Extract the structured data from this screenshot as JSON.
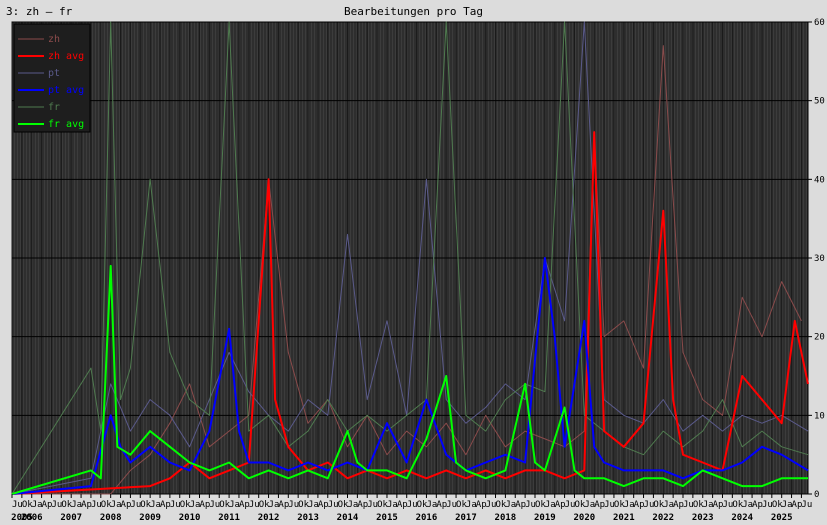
{
  "header": {
    "panel_title": "3: zh – fr",
    "chart_title": "Bearbeitungen pro Tag"
  },
  "colors": {
    "page_background": "#dcdcdc",
    "plot_background": "#2e2e2e",
    "grid": "#000000",
    "zh": "#8a4b4b",
    "zh_avg": "#ff0000",
    "pt": "#5a5a8a",
    "pt_avg": "#0000ff",
    "fr": "#4f7a4f",
    "fr_avg": "#00ff00"
  },
  "chart_data": {
    "type": "line",
    "title": "Bearbeitungen pro Tag",
    "y_axis_position": "right",
    "ylim": [
      0,
      60
    ],
    "yticks": [
      "0",
      "10",
      "20",
      "30",
      "40",
      "50",
      "60"
    ],
    "grid": true,
    "legend_position": "top-left",
    "x_start": "2005-07",
    "x_end": "2025-09",
    "year_labels": [
      "2005",
      "2006",
      "2007",
      "2008",
      "2009",
      "2010",
      "2011",
      "2012",
      "2013",
      "2014",
      "2015",
      "2016",
      "2017",
      "2018",
      "2019",
      "2020",
      "2021",
      "2022",
      "2023",
      "2024",
      "2025"
    ],
    "month_tick_labels": [
      "Ju",
      "Ok",
      "Ja",
      "Ap"
    ],
    "series": [
      {
        "name": "zh",
        "key": "zh",
        "kind": "raw",
        "points": [
          [
            "2005-07",
            0
          ],
          [
            "2008-01",
            0
          ],
          [
            "2008-07",
            3
          ],
          [
            "2009-01",
            5
          ],
          [
            "2009-07",
            9
          ],
          [
            "2010-01",
            14
          ],
          [
            "2010-07",
            6
          ],
          [
            "2011-01",
            8
          ],
          [
            "2011-07",
            10
          ],
          [
            "2012-01",
            40
          ],
          [
            "2012-07",
            18
          ],
          [
            "2013-01",
            9
          ],
          [
            "2013-07",
            12
          ],
          [
            "2014-01",
            6
          ],
          [
            "2014-07",
            10
          ],
          [
            "2015-01",
            5
          ],
          [
            "2015-07",
            8
          ],
          [
            "2016-01",
            6
          ],
          [
            "2016-07",
            9
          ],
          [
            "2017-01",
            5
          ],
          [
            "2017-07",
            10
          ],
          [
            "2018-01",
            6
          ],
          [
            "2018-07",
            8
          ],
          [
            "2019-01",
            7
          ],
          [
            "2019-07",
            6
          ],
          [
            "2020-01",
            8
          ],
          [
            "2020-04",
            46
          ],
          [
            "2020-07",
            20
          ],
          [
            "2021-01",
            22
          ],
          [
            "2021-07",
            16
          ],
          [
            "2022-01",
            57
          ],
          [
            "2022-07",
            18
          ],
          [
            "2023-01",
            12
          ],
          [
            "2023-07",
            10
          ],
          [
            "2024-01",
            25
          ],
          [
            "2024-07",
            20
          ],
          [
            "2025-01",
            27
          ],
          [
            "2025-07",
            22
          ]
        ]
      },
      {
        "name": "zh avg",
        "key": "zh_avg",
        "kind": "avg",
        "points": [
          [
            "2005-07",
            0
          ],
          [
            "2009-01",
            1
          ],
          [
            "2009-07",
            2
          ],
          [
            "2010-01",
            4
          ],
          [
            "2010-07",
            2
          ],
          [
            "2011-01",
            3
          ],
          [
            "2011-07",
            4
          ],
          [
            "2012-01",
            40
          ],
          [
            "2012-03",
            12
          ],
          [
            "2012-07",
            6
          ],
          [
            "2013-01",
            3
          ],
          [
            "2013-07",
            4
          ],
          [
            "2014-01",
            2
          ],
          [
            "2014-07",
            3
          ],
          [
            "2015-01",
            2
          ],
          [
            "2015-07",
            3
          ],
          [
            "2016-01",
            2
          ],
          [
            "2016-07",
            3
          ],
          [
            "2017-01",
            2
          ],
          [
            "2017-07",
            3
          ],
          [
            "2018-01",
            2
          ],
          [
            "2018-07",
            3
          ],
          [
            "2019-01",
            3
          ],
          [
            "2019-07",
            2
          ],
          [
            "2020-01",
            3
          ],
          [
            "2020-04",
            46
          ],
          [
            "2020-07",
            8
          ],
          [
            "2021-01",
            6
          ],
          [
            "2021-07",
            9
          ],
          [
            "2022-01",
            36
          ],
          [
            "2022-04",
            12
          ],
          [
            "2022-07",
            5
          ],
          [
            "2023-01",
            4
          ],
          [
            "2023-07",
            3
          ],
          [
            "2024-01",
            15
          ],
          [
            "2024-07",
            12
          ],
          [
            "2025-01",
            9
          ],
          [
            "2025-05",
            22
          ],
          [
            "2025-09",
            14
          ]
        ]
      },
      {
        "name": "pt",
        "key": "pt",
        "kind": "raw",
        "points": [
          [
            "2005-07",
            0
          ],
          [
            "2007-07",
            2
          ],
          [
            "2008-01",
            14
          ],
          [
            "2008-07",
            8
          ],
          [
            "2009-01",
            12
          ],
          [
            "2009-07",
            10
          ],
          [
            "2010-01",
            6
          ],
          [
            "2010-07",
            12
          ],
          [
            "2011-01",
            18
          ],
          [
            "2011-07",
            13
          ],
          [
            "2012-01",
            10
          ],
          [
            "2012-07",
            8
          ],
          [
            "2013-01",
            12
          ],
          [
            "2013-07",
            10
          ],
          [
            "2014-01",
            33
          ],
          [
            "2014-07",
            12
          ],
          [
            "2015-01",
            22
          ],
          [
            "2015-07",
            10
          ],
          [
            "2016-01",
            40
          ],
          [
            "2016-07",
            12
          ],
          [
            "2017-01",
            9
          ],
          [
            "2017-07",
            11
          ],
          [
            "2018-01",
            14
          ],
          [
            "2018-07",
            12
          ],
          [
            "2019-01",
            30
          ],
          [
            "2019-07",
            22
          ],
          [
            "2020-01",
            60
          ],
          [
            "2020-07",
            12
          ],
          [
            "2021-01",
            10
          ],
          [
            "2021-07",
            9
          ],
          [
            "2022-01",
            12
          ],
          [
            "2022-07",
            8
          ],
          [
            "2023-01",
            10
          ],
          [
            "2023-07",
            8
          ],
          [
            "2024-01",
            10
          ],
          [
            "2024-07",
            9
          ],
          [
            "2025-01",
            10
          ],
          [
            "2025-09",
            8
          ]
        ]
      },
      {
        "name": "pt avg",
        "key": "pt_avg",
        "kind": "avg",
        "points": [
          [
            "2005-07",
            0
          ],
          [
            "2007-07",
            1
          ],
          [
            "2008-01",
            10
          ],
          [
            "2008-04",
            6
          ],
          [
            "2008-07",
            4
          ],
          [
            "2009-01",
            6
          ],
          [
            "2009-07",
            4
          ],
          [
            "2010-01",
            3
          ],
          [
            "2010-07",
            8
          ],
          [
            "2011-01",
            21
          ],
          [
            "2011-04",
            8
          ],
          [
            "2011-07",
            4
          ],
          [
            "2012-01",
            4
          ],
          [
            "2012-07",
            3
          ],
          [
            "2013-01",
            4
          ],
          [
            "2013-07",
            3
          ],
          [
            "2014-01",
            4
          ],
          [
            "2014-07",
            3
          ],
          [
            "2015-01",
            9
          ],
          [
            "2015-07",
            4
          ],
          [
            "2016-01",
            12
          ],
          [
            "2016-07",
            5
          ],
          [
            "2017-01",
            3
          ],
          [
            "2017-07",
            4
          ],
          [
            "2018-01",
            5
          ],
          [
            "2018-07",
            4
          ],
          [
            "2019-01",
            30
          ],
          [
            "2019-04",
            20
          ],
          [
            "2019-07",
            6
          ],
          [
            "2020-01",
            22
          ],
          [
            "2020-04",
            6
          ],
          [
            "2020-07",
            4
          ],
          [
            "2021-01",
            3
          ],
          [
            "2021-07",
            3
          ],
          [
            "2022-01",
            3
          ],
          [
            "2022-07",
            2
          ],
          [
            "2023-01",
            3
          ],
          [
            "2023-07",
            3
          ],
          [
            "2024-01",
            4
          ],
          [
            "2024-07",
            6
          ],
          [
            "2025-01",
            5
          ],
          [
            "2025-09",
            3
          ]
        ]
      },
      {
        "name": "fr",
        "key": "fr",
        "kind": "raw",
        "points": [
          [
            "2005-07",
            0
          ],
          [
            "2007-07",
            16
          ],
          [
            "2007-10",
            8
          ],
          [
            "2008-01",
            60
          ],
          [
            "2008-04",
            12
          ],
          [
            "2008-07",
            16
          ],
          [
            "2009-01",
            40
          ],
          [
            "2009-07",
            18
          ],
          [
            "2010-01",
            12
          ],
          [
            "2010-07",
            10
          ],
          [
            "2011-01",
            60
          ],
          [
            "2011-07",
            8
          ],
          [
            "2012-01",
            10
          ],
          [
            "2012-07",
            6
          ],
          [
            "2013-01",
            8
          ],
          [
            "2013-07",
            12
          ],
          [
            "2014-01",
            8
          ],
          [
            "2014-07",
            10
          ],
          [
            "2015-01",
            8
          ],
          [
            "2015-07",
            10
          ],
          [
            "2016-01",
            12
          ],
          [
            "2016-07",
            60
          ],
          [
            "2017-01",
            10
          ],
          [
            "2017-07",
            8
          ],
          [
            "2018-01",
            12
          ],
          [
            "2018-07",
            14
          ],
          [
            "2019-01",
            13
          ],
          [
            "2019-07",
            60
          ],
          [
            "2020-01",
            10
          ],
          [
            "2020-07",
            8
          ],
          [
            "2021-01",
            6
          ],
          [
            "2021-07",
            5
          ],
          [
            "2022-01",
            8
          ],
          [
            "2022-07",
            6
          ],
          [
            "2023-01",
            8
          ],
          [
            "2023-07",
            12
          ],
          [
            "2024-01",
            6
          ],
          [
            "2024-07",
            8
          ],
          [
            "2025-01",
            6
          ],
          [
            "2025-09",
            5
          ]
        ]
      },
      {
        "name": "fr avg",
        "key": "fr_avg",
        "kind": "avg",
        "points": [
          [
            "2005-07",
            0
          ],
          [
            "2007-07",
            3
          ],
          [
            "2007-10",
            2
          ],
          [
            "2008-01",
            29
          ],
          [
            "2008-03",
            6
          ],
          [
            "2008-07",
            5
          ],
          [
            "2009-01",
            8
          ],
          [
            "2009-07",
            6
          ],
          [
            "2010-01",
            4
          ],
          [
            "2010-07",
            3
          ],
          [
            "2011-01",
            4
          ],
          [
            "2011-07",
            2
          ],
          [
            "2012-01",
            3
          ],
          [
            "2012-07",
            2
          ],
          [
            "2013-01",
            3
          ],
          [
            "2013-07",
            2
          ],
          [
            "2014-01",
            8
          ],
          [
            "2014-04",
            4
          ],
          [
            "2014-07",
            3
          ],
          [
            "2015-01",
            3
          ],
          [
            "2015-07",
            2
          ],
          [
            "2016-01",
            7
          ],
          [
            "2016-07",
            15
          ],
          [
            "2016-10",
            4
          ],
          [
            "2017-01",
            3
          ],
          [
            "2017-07",
            2
          ],
          [
            "2018-01",
            3
          ],
          [
            "2018-07",
            14
          ],
          [
            "2018-10",
            4
          ],
          [
            "2019-01",
            3
          ],
          [
            "2019-07",
            11
          ],
          [
            "2019-10",
            3
          ],
          [
            "2020-01",
            2
          ],
          [
            "2020-07",
            2
          ],
          [
            "2021-01",
            1
          ],
          [
            "2021-07",
            2
          ],
          [
            "2022-01",
            2
          ],
          [
            "2022-07",
            1
          ],
          [
            "2023-01",
            3
          ],
          [
            "2023-07",
            2
          ],
          [
            "2024-01",
            1
          ],
          [
            "2024-07",
            1
          ],
          [
            "2025-01",
            2
          ],
          [
            "2025-09",
            2
          ]
        ]
      }
    ]
  }
}
